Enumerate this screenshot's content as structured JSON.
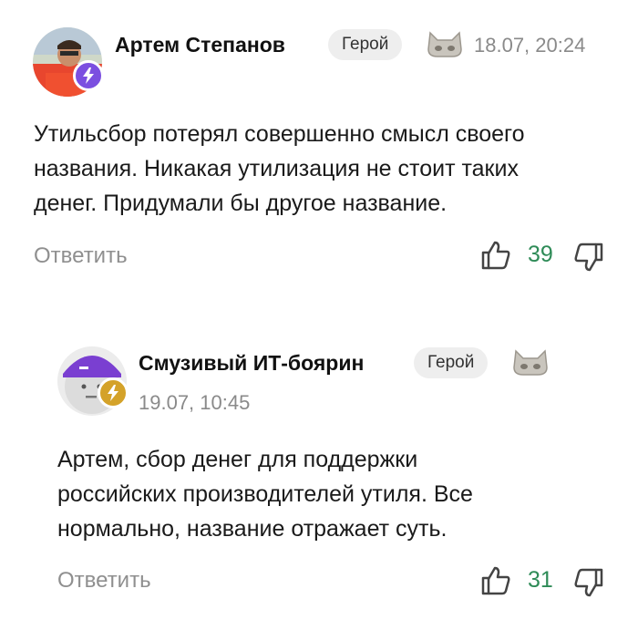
{
  "comments": [
    {
      "author": "Артем Степанов",
      "rank": "Герой",
      "timestamp": "18.07, 20:24",
      "text_lines": [
        "Утильсбор потерял совершенно смысл своего",
        "названия. Никакая утилизация не стоит таких",
        "денег. Придумали бы другое название."
      ],
      "reply_label": "Ответить",
      "likes": "39",
      "badge_color": "#7b4fe0"
    },
    {
      "author": "Смузивый ИТ-боярин",
      "rank": "Герой",
      "timestamp": "19.07, 10:45",
      "text_lines": [
        "Артем, сбор денег для поддержки",
        "российских производителей утиля. Все",
        "нормально, название отражает суть."
      ],
      "reply_label": "Ответить",
      "likes": "31",
      "badge_color": "#d4a229"
    }
  ],
  "colors": {
    "like_count": "#2e8b57",
    "muted": "#8a8a8a",
    "rank_bg": "#eeeeee"
  },
  "icons": {
    "rank_icon": "mask-icon",
    "like": "thumbs-up-icon",
    "dislike": "thumbs-down-icon",
    "badge": "lightning-icon"
  }
}
